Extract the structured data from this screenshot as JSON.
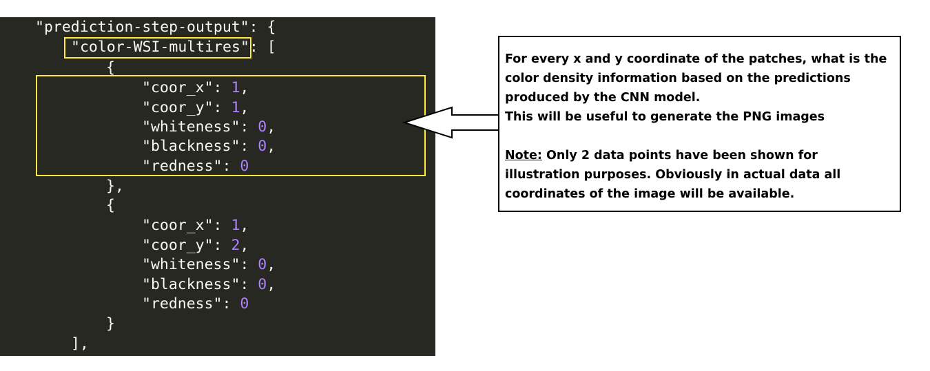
{
  "code": {
    "lines": [
      [
        {
          "t": "\"prediction-step-output\": {",
          "k": "plain"
        }
      ],
      [
        {
          "t": "\"color-WSI-multires\": [",
          "k": "plain"
        }
      ],
      [
        {
          "t": "{",
          "k": "plain"
        }
      ],
      [
        {
          "t": "\"coor_x\": ",
          "k": "plain"
        },
        {
          "t": "1",
          "k": "num"
        },
        {
          "t": ",",
          "k": "plain"
        }
      ],
      [
        {
          "t": "\"coor_y\": ",
          "k": "plain"
        },
        {
          "t": "1",
          "k": "num"
        },
        {
          "t": ",",
          "k": "plain"
        }
      ],
      [
        {
          "t": "\"whiteness\": ",
          "k": "plain"
        },
        {
          "t": "0",
          "k": "num"
        },
        {
          "t": ",",
          "k": "plain"
        }
      ],
      [
        {
          "t": "\"blackness\": ",
          "k": "plain"
        },
        {
          "t": "0",
          "k": "num"
        },
        {
          "t": ",",
          "k": "plain"
        }
      ],
      [
        {
          "t": "\"redness\": ",
          "k": "plain"
        },
        {
          "t": "0",
          "k": "num"
        }
      ],
      [
        {
          "t": "},",
          "k": "plain"
        }
      ],
      [
        {
          "t": "{",
          "k": "plain"
        }
      ],
      [
        {
          "t": "\"coor_x\": ",
          "k": "plain"
        },
        {
          "t": "1",
          "k": "num"
        },
        {
          "t": ",",
          "k": "plain"
        }
      ],
      [
        {
          "t": "\"coor_y\": ",
          "k": "plain"
        },
        {
          "t": "2",
          "k": "num"
        },
        {
          "t": ",",
          "k": "plain"
        }
      ],
      [
        {
          "t": "\"whiteness\": ",
          "k": "plain"
        },
        {
          "t": "0",
          "k": "num"
        },
        {
          "t": ",",
          "k": "plain"
        }
      ],
      [
        {
          "t": "\"blackness\": ",
          "k": "plain"
        },
        {
          "t": "0",
          "k": "num"
        },
        {
          "t": ",",
          "k": "plain"
        }
      ],
      [
        {
          "t": "\"redness\": ",
          "k": "plain"
        },
        {
          "t": "0",
          "k": "num"
        }
      ],
      [
        {
          "t": "}",
          "k": "plain"
        }
      ],
      [
        {
          "t": "],",
          "k": "plain"
        }
      ]
    ]
  },
  "annotation": {
    "text": "For every x and y coordinate of the patches, what is the color density information based on the predictions produced by the CNN model.",
    "text2": "This will be useful to generate the PNG images",
    "note_label": "Note:",
    "note_text": " Only 2 data points have been shown for illustration purposes. Obviously in actual data all coordinates of the image will be available."
  },
  "colors": {
    "editor_bg": "#272822",
    "code_text": "#f8f8f2",
    "number": "#ae81ff",
    "highlight": "#ffeb3b"
  },
  "icons": {
    "arrow": "left-arrow-icon"
  }
}
